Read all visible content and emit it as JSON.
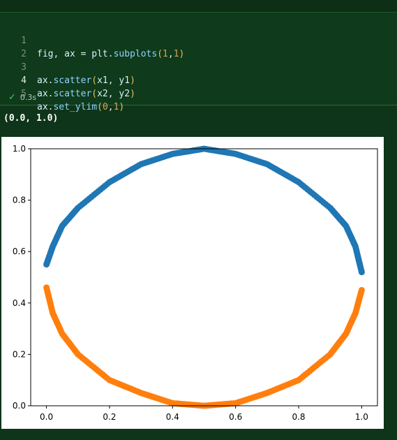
{
  "code_lines": [
    {
      "num": "1",
      "text": "fig, ax = plt.subplots(1,1)"
    },
    {
      "num": "2",
      "text": ""
    },
    {
      "num": "3",
      "text": "ax.scatter(x1, y1)"
    },
    {
      "num": "4",
      "text": "ax.scatter(x2, y2)"
    },
    {
      "num": "5",
      "text": "ax.set_ylim(0,1)"
    }
  ],
  "status": {
    "duration": "0.3s"
  },
  "output": {
    "text": "(0.0, 1.0)"
  },
  "chart_data": {
    "type": "scatter",
    "xlim": [
      -0.05,
      1.05
    ],
    "ylim": [
      0,
      1
    ],
    "xticks": [
      "0.0",
      "0.2",
      "0.4",
      "0.6",
      "0.8",
      "1.0"
    ],
    "yticks": [
      "0.0",
      "0.2",
      "0.4",
      "0.6",
      "0.8",
      "1.0"
    ],
    "series": [
      {
        "color": "#1f77b4",
        "x": [
          0,
          0.02,
          0.05,
          0.1,
          0.2,
          0.3,
          0.4,
          0.5,
          0.6,
          0.7,
          0.8,
          0.9,
          0.95,
          0.98,
          1.0
        ],
        "y": [
          0.55,
          0.62,
          0.7,
          0.77,
          0.87,
          0.94,
          0.98,
          1.0,
          0.98,
          0.94,
          0.87,
          0.77,
          0.7,
          0.62,
          0.52
        ]
      },
      {
        "color": "#ff7f0e",
        "x": [
          0,
          0.02,
          0.05,
          0.1,
          0.2,
          0.3,
          0.4,
          0.5,
          0.6,
          0.7,
          0.8,
          0.9,
          0.95,
          0.98,
          1.0
        ],
        "y": [
          0.46,
          0.36,
          0.28,
          0.2,
          0.1,
          0.05,
          0.01,
          0.0,
          0.01,
          0.05,
          0.1,
          0.2,
          0.28,
          0.36,
          0.45
        ]
      }
    ]
  }
}
